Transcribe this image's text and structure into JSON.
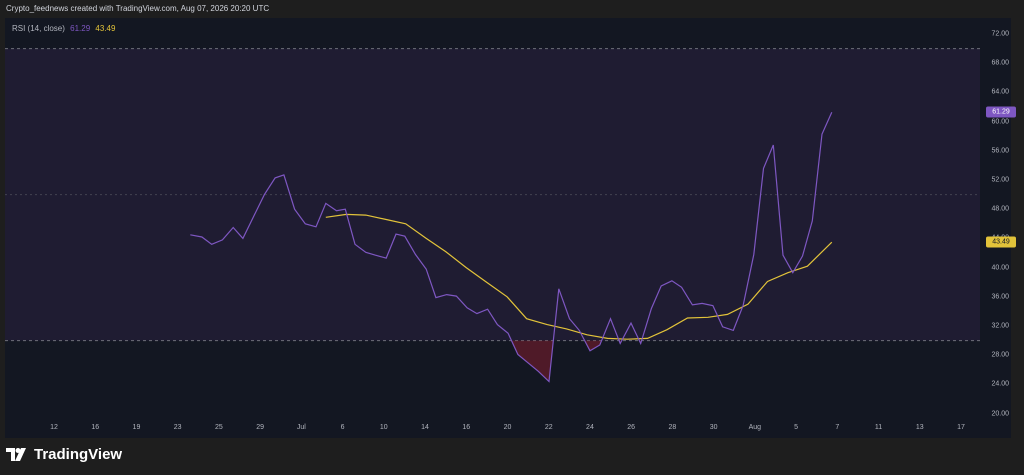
{
  "header": {
    "attribution": "Crypto_feednews created with TradingView.com, Aug 07, 2026 20:20 UTC"
  },
  "legend": {
    "label": "RSI (14, close)",
    "rsi_value": "61.29",
    "ma_value": "43.49"
  },
  "footer": {
    "brand": "TradingView"
  },
  "colors": {
    "rsi": "#7e57c2",
    "ma": "#e2c33a",
    "band": "#2a2040",
    "oversold_fill": "#8b1e2e",
    "background": "#131722"
  },
  "chart_data": {
    "type": "line",
    "x_tick_labels": [
      "12",
      "16",
      "19",
      "23",
      "25",
      "29",
      "Jul",
      "6",
      "10",
      "14",
      "16",
      "20",
      "22",
      "24",
      "26",
      "28",
      "30",
      "Aug",
      "5",
      "7",
      "11",
      "13",
      "17"
    ],
    "y_ticks": [
      20,
      24,
      28,
      32,
      36,
      40,
      44,
      48,
      52,
      56,
      60,
      64,
      68,
      72
    ],
    "ylim": [
      19.4,
      74.2
    ],
    "xlim": [
      0,
      100
    ],
    "levels": {
      "upper": 70,
      "middle": 50,
      "lower": 30
    },
    "series": [
      {
        "values": [
          [
            19.0,
            44.5
          ],
          [
            20.2,
            44.2
          ],
          [
            21.2,
            43.2
          ],
          [
            22.3,
            43.8
          ],
          [
            23.4,
            45.5
          ],
          [
            24.4,
            44.0
          ],
          [
            25.5,
            47.0
          ],
          [
            26.6,
            50.0
          ],
          [
            27.7,
            52.3
          ],
          [
            28.6,
            52.7
          ],
          [
            29.7,
            48.0
          ],
          [
            30.8,
            46.0
          ],
          [
            31.9,
            45.6
          ],
          [
            32.9,
            48.8
          ],
          [
            34.0,
            47.8
          ],
          [
            34.9,
            48.0
          ],
          [
            35.9,
            43.2
          ],
          [
            37.0,
            42.1
          ],
          [
            38.0,
            41.7
          ],
          [
            39.1,
            41.3
          ],
          [
            40.1,
            44.6
          ],
          [
            41.0,
            44.3
          ],
          [
            42.1,
            41.8
          ],
          [
            43.2,
            39.8
          ],
          [
            44.2,
            35.9
          ],
          [
            45.3,
            36.3
          ],
          [
            46.3,
            36.1
          ],
          [
            47.4,
            34.5
          ],
          [
            48.4,
            33.7
          ],
          [
            49.5,
            34.3
          ],
          [
            50.5,
            32.2
          ],
          [
            51.6,
            31.0
          ],
          [
            52.6,
            28.1
          ],
          [
            53.7,
            26.9
          ],
          [
            54.7,
            25.8
          ],
          [
            55.8,
            24.4
          ],
          [
            56.8,
            37.1
          ],
          [
            57.9,
            33.0
          ],
          [
            58.9,
            31.4
          ],
          [
            60.0,
            28.6
          ],
          [
            61.0,
            29.4
          ],
          [
            62.1,
            33.0
          ],
          [
            63.1,
            29.6
          ],
          [
            64.2,
            32.4
          ],
          [
            65.2,
            29.6
          ],
          [
            66.3,
            34.4
          ],
          [
            67.3,
            37.5
          ],
          [
            68.4,
            38.2
          ],
          [
            69.4,
            37.3
          ],
          [
            70.5,
            34.9
          ],
          [
            71.5,
            35.1
          ],
          [
            72.6,
            34.8
          ],
          [
            73.6,
            31.9
          ],
          [
            74.7,
            31.4
          ],
          [
            75.7,
            34.8
          ],
          [
            76.8,
            41.8
          ],
          [
            77.8,
            53.6
          ],
          [
            78.8,
            56.8
          ],
          [
            79.8,
            41.7
          ],
          [
            80.8,
            39.3
          ],
          [
            81.8,
            41.6
          ],
          [
            82.8,
            46.4
          ],
          [
            83.8,
            58.3
          ],
          [
            84.8,
            61.29
          ]
        ]
      },
      {
        "values": [
          [
            32.9,
            46.9
          ],
          [
            35.0,
            47.3
          ],
          [
            37.0,
            47.2
          ],
          [
            39.1,
            46.6
          ],
          [
            41.1,
            46.0
          ],
          [
            43.2,
            44.0
          ],
          [
            45.2,
            42.2
          ],
          [
            47.3,
            40.0
          ],
          [
            49.4,
            38.0
          ],
          [
            51.5,
            36.0
          ],
          [
            53.5,
            33.0
          ],
          [
            55.6,
            32.2
          ],
          [
            57.6,
            31.6
          ],
          [
            59.7,
            30.8
          ],
          [
            61.8,
            30.3
          ],
          [
            63.8,
            30.2
          ],
          [
            65.9,
            30.3
          ],
          [
            67.9,
            31.5
          ],
          [
            70.0,
            33.1
          ],
          [
            72.1,
            33.2
          ],
          [
            74.1,
            33.6
          ],
          [
            76.2,
            35.0
          ],
          [
            78.2,
            38.1
          ],
          [
            80.3,
            39.3
          ],
          [
            82.3,
            40.2
          ],
          [
            84.8,
            43.49
          ]
        ]
      }
    ]
  }
}
